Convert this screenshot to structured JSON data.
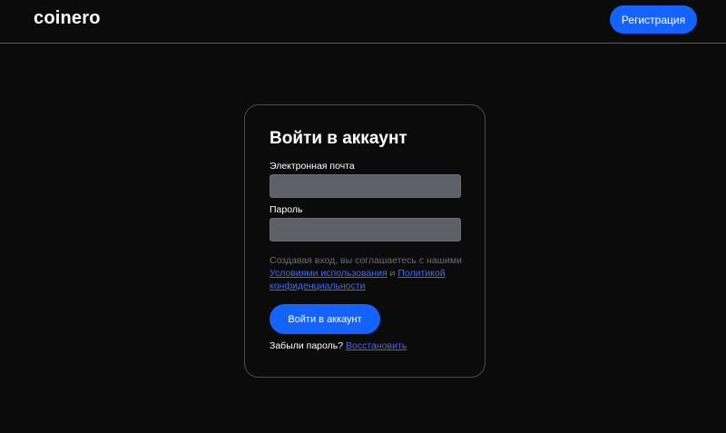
{
  "header": {
    "logo": "coinero",
    "register_label": "Регистрация"
  },
  "login_card": {
    "title": "Войти в аккаунт",
    "email_label": "Электронная почта",
    "email_value": "",
    "password_label": "Пароль",
    "password_value": "",
    "consent_prefix": "Создавая вход, вы соглашаетесь с нашими",
    "terms_link": "Условиями использования",
    "consent_and": "и",
    "privacy_link_1": "Политикой",
    "privacy_link_2": "конфиденциальности",
    "submit_label": "Войти в аккаунт",
    "forgot_text": "Забыли пароль?",
    "restore_link": "Восстановить"
  },
  "colors": {
    "background": "#0b0b0c",
    "accent": "#1463ff",
    "link": "#3a6cff",
    "input_fill": "#5e6068",
    "muted_text": "#6b6e78"
  }
}
